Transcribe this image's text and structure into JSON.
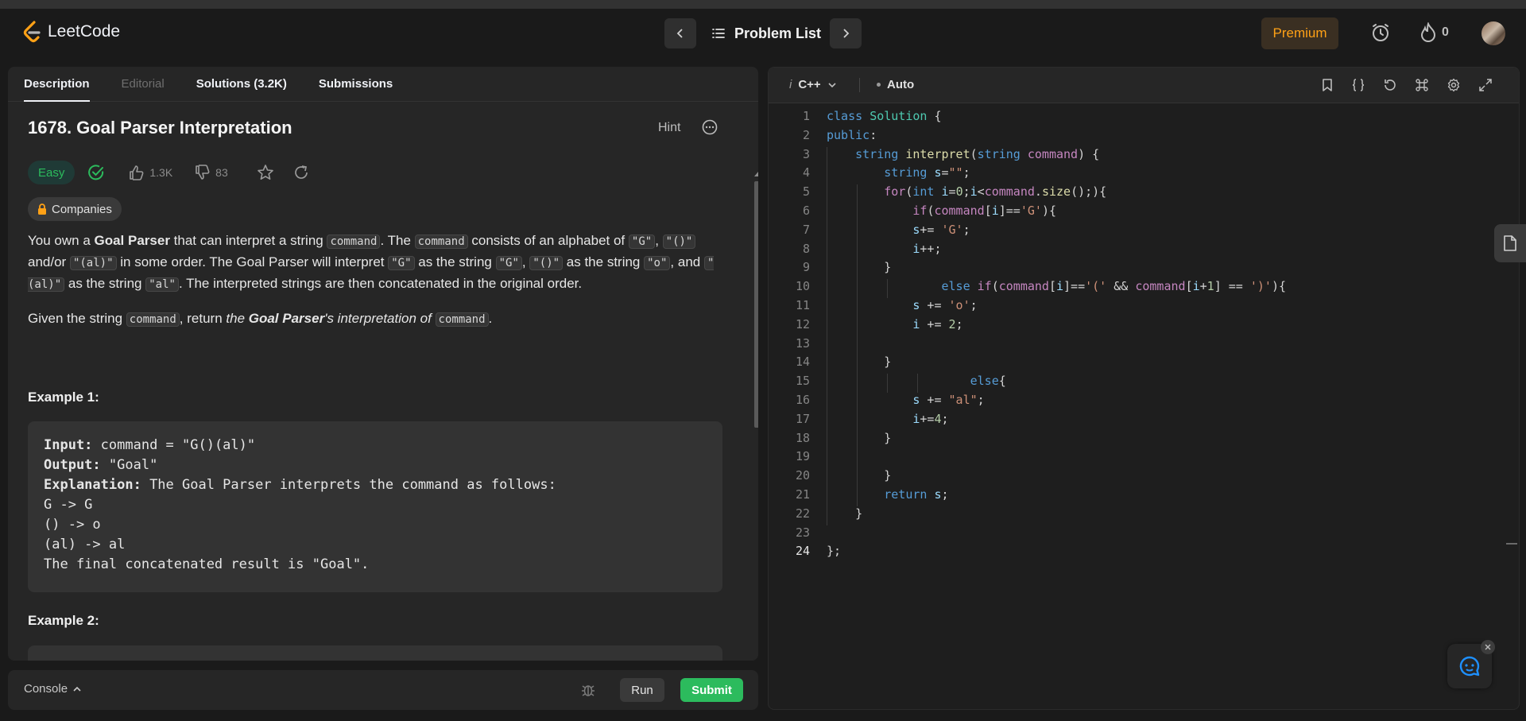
{
  "header": {
    "logo_text": "LeetCode",
    "problem_list_label": "Problem List",
    "premium_label": "Premium",
    "streak_count": "0"
  },
  "tabs": [
    {
      "label": "Description",
      "active": true
    },
    {
      "label": "Editorial",
      "disabled": true
    },
    {
      "label": "Solutions (3.2K)"
    },
    {
      "label": "Submissions"
    }
  ],
  "problem": {
    "title": "1678. Goal Parser Interpretation",
    "hint_label": "Hint",
    "difficulty": "Easy",
    "likes": "1.3K",
    "dislikes": "83",
    "companies_label": "Companies",
    "p1": {
      "t1": "You own a ",
      "b1": "Goal Parser",
      "t2": " that can interpret a string ",
      "c1": "command",
      "t3": ". The ",
      "c2": "command",
      "t4": " consists of an alphabet of ",
      "c3": "\"G\"",
      "t5": ", ",
      "c4": "\"()\"",
      "t6": " and/or ",
      "c5": "\"(al)\"",
      "t7": " in some order. The Goal Parser will interpret ",
      "c6": "\"G\"",
      "t8": " as the string ",
      "c7": "\"G\"",
      "t9": ", ",
      "c8": "\"()\"",
      "t10": " as the string ",
      "c9": "\"o\"",
      "t11": ", and ",
      "c10": "\"(al)\"",
      "t12": " as the string ",
      "c11": "\"al\"",
      "t13": ". The interpreted strings are then concatenated in the original order."
    },
    "p2": {
      "t1": "Given the string ",
      "c1": "command",
      "t2": ", return ",
      "i1": "the ",
      "bi1": "Goal Parser",
      "i2": "'s interpretation of ",
      "c2": "command",
      "t3": "."
    },
    "example1_title": "Example 1:",
    "example1": {
      "input_label": "Input:",
      "input_value": " command = \"G()(al)\"",
      "output_label": "Output:",
      "output_value": " \"Goal\"",
      "explanation_label": "Explanation:",
      "explanation_value": " The Goal Parser interprets the command as follows:",
      "line1": "G -> G",
      "line2": "() -> o",
      "line3": "(al) -> al",
      "line4": "The final concatenated result is \"Goal\"."
    },
    "example2_title": "Example 2:"
  },
  "console": {
    "label": "Console",
    "run_label": "Run",
    "submit_label": "Submit"
  },
  "editor": {
    "language": "C++",
    "language_prefix": "i",
    "mode": "Auto",
    "line_numbers": [
      "1",
      "2",
      "3",
      "4",
      "5",
      "6",
      "7",
      "8",
      "9",
      "10",
      "11",
      "12",
      "13",
      "14",
      "15",
      "16",
      "17",
      "18",
      "19",
      "20",
      "21",
      "22",
      "23",
      "24"
    ],
    "active_line": "24",
    "code": [
      "class Solution {",
      "public:",
      "    string interpret(string command) {",
      "        string s=\"\";",
      "        for(int i=0;i<command.size();){",
      "            if(command[i]=='G'){",
      "            s+= 'G';",
      "            i++;",
      "        }",
      "                else if(command[i]=='(' && command[i+1] == ')'){",
      "            s += 'o';",
      "            i += 2;",
      "",
      "        }",
      "                    else{",
      "            s += \"al\";",
      "            i+=4;",
      "        }",
      "",
      "        }",
      "        return s;",
      "    }",
      "",
      "};"
    ]
  },
  "colors": {
    "accent_green": "#2cbb5d",
    "premium_orange": "#ffa116",
    "background": "#1a1a1a",
    "panel": "#262626"
  }
}
